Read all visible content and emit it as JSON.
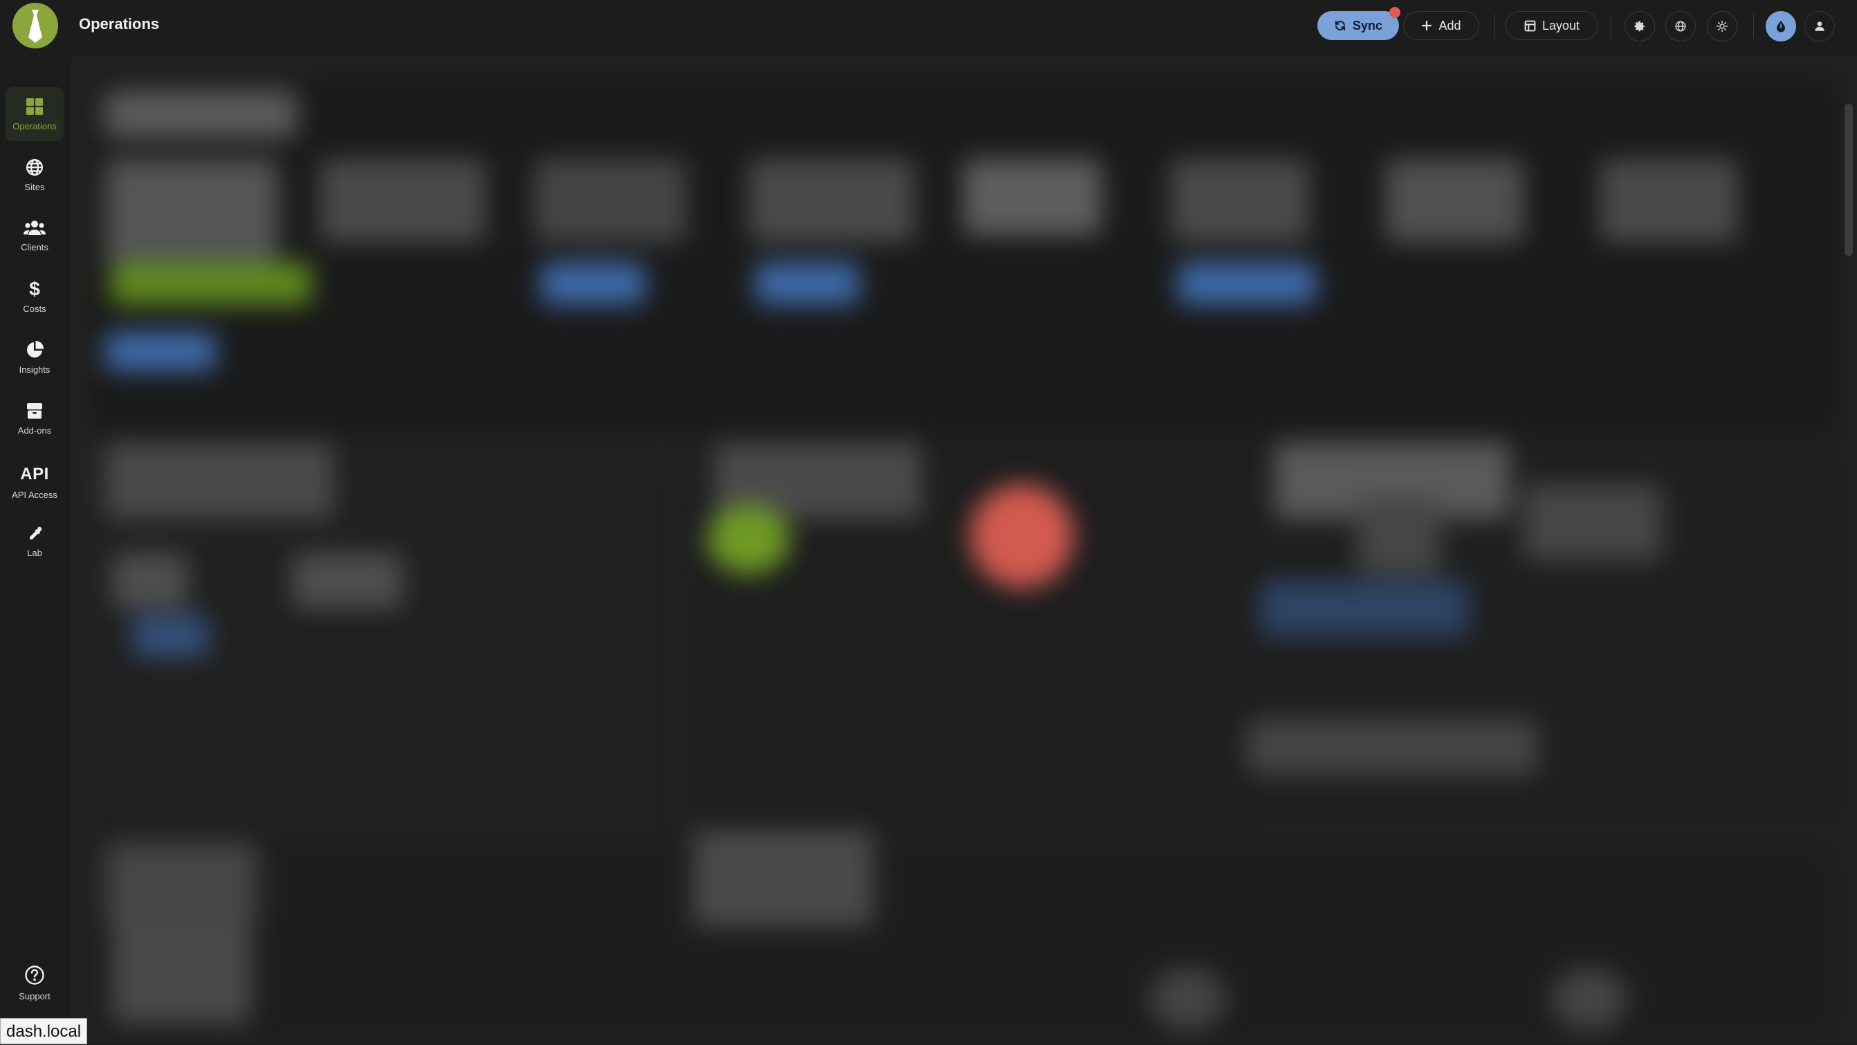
{
  "app": {
    "title": "Operations"
  },
  "toolbar": {
    "sync_label": "Sync",
    "add_label": "Add",
    "layout_label": "Layout",
    "icons": [
      "sync-icon",
      "plus-icon",
      "grid-icon",
      "gear-icon",
      "globe-icon",
      "sun-icon",
      "theme-drop-icon",
      "user-icon"
    ]
  },
  "sidebar": {
    "items": [
      {
        "label": "Operations",
        "icon": "grid-icon",
        "active": true
      },
      {
        "label": "Sites",
        "icon": "globe-icon"
      },
      {
        "label": "Clients",
        "icon": "users-icon"
      },
      {
        "label": "Costs",
        "icon": "dollar-icon"
      },
      {
        "label": "Insights",
        "icon": "pie-chart-icon"
      },
      {
        "label": "Add-ons",
        "icon": "box-icon"
      },
      {
        "label": "API Access",
        "icon": "api-text",
        "glyph": "API"
      },
      {
        "label": "Lab",
        "icon": "pipette-icon"
      },
      {
        "label": "Support",
        "icon": "help-circle-icon"
      }
    ]
  },
  "status_bar": {
    "url": "dash.local"
  },
  "colors": {
    "background": "#1c1c1c",
    "panel": "#222222",
    "accent_green": "#8aa63c",
    "accent_blue": "#7aa2d8",
    "alert_red": "#e05a52"
  }
}
